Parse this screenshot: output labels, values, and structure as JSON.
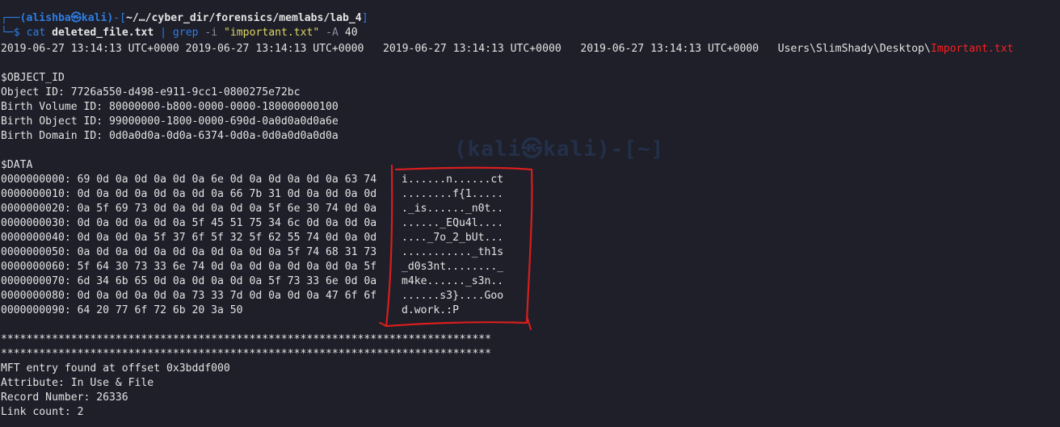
{
  "prompt": {
    "user_host": "(alishba㉿kali)",
    "path": "~/…/cyber_dir/forensics/memlabs/lab_4",
    "command": "cat",
    "file": "deleted_file.txt",
    "pipe": "|",
    "grep": "grep",
    "flag_i": "-i",
    "pattern": "\"important.txt\"",
    "flag_A": "-A",
    "count": "40"
  },
  "timestamps": {
    "prefix": "2019-06-27 13:14:13 UTC+0000 2019-06-27 13:14:13 UTC+0000   2019-06-27 13:14:13 UTC+0000   2019-06-27 13:14:13 UTC+0000   Users\\SlimShady\\Desktop\\",
    "highlight": "Important.txt"
  },
  "object_id": {
    "header": "$OBJECT_ID",
    "lines": [
      "Object ID: 7726a550-d498-e911-9cc1-0800275e72bc",
      "Birth Volume ID: 80000000-b800-0000-0000-180000000100",
      "Birth Object ID: 99000000-1800-0000-690d-0a0d0a0d0a6e",
      "Birth Domain ID: 0d0a0d0a-0d0a-6374-0d0a-0d0a0d0a0d0a"
    ]
  },
  "data": {
    "header": "$DATA",
    "rows": [
      {
        "offset": "0000000000:",
        "bytes": "69 0d 0a 0d 0a 0d 0a 6e 0d 0a 0d 0a 0d 0a 63 74",
        "ascii": "i......n......ct"
      },
      {
        "offset": "0000000010:",
        "bytes": "0d 0a 0d 0a 0d 0a 0d 0a 66 7b 31 0d 0a 0d 0a 0d",
        "ascii": "........f{1....."
      },
      {
        "offset": "0000000020:",
        "bytes": "0a 5f 69 73 0d 0a 0d 0a 0d 0a 5f 6e 30 74 0d 0a",
        "ascii": "._is......_n0t.."
      },
      {
        "offset": "0000000030:",
        "bytes": "0d 0a 0d 0a 0d 0a 5f 45 51 75 34 6c 0d 0a 0d 0a",
        "ascii": "......_EQu4l...."
      },
      {
        "offset": "0000000040:",
        "bytes": "0d 0a 0d 0a 5f 37 6f 5f 32 5f 62 55 74 0d 0a 0d",
        "ascii": "...._7o_2_bUt..."
      },
      {
        "offset": "0000000050:",
        "bytes": "0a 0d 0a 0d 0a 0d 0a 0d 0a 0d 0a 5f 74 68 31 73",
        "ascii": "..........._th1s"
      },
      {
        "offset": "0000000060:",
        "bytes": "5f 64 30 73 33 6e 74 0d 0a 0d 0a 0d 0a 0d 0a 5f",
        "ascii": "_d0s3nt........_"
      },
      {
        "offset": "0000000070:",
        "bytes": "6d 34 6b 65 0d 0a 0d 0a 0d 0a 5f 73 33 6e 0d 0a",
        "ascii": "m4ke......_s3n.."
      },
      {
        "offset": "0000000080:",
        "bytes": "0d 0a 0d 0a 0d 0a 73 33 7d 0d 0a 0d 0a 47 6f 6f",
        "ascii": "......s3}....Goo"
      },
      {
        "offset": "0000000090:",
        "bytes": "64 20 77 6f 72 6b 20 3a 50",
        "ascii": "d.work.:P"
      }
    ]
  },
  "footer": {
    "separator": "*****************************************************************************",
    "lines": [
      "MFT entry found at offset 0x3bddf000",
      "Attribute: In Use & File",
      "Record Number: 26336",
      "Link count: 2"
    ]
  },
  "watermark": "(kali㉿kali)-[~]",
  "colors": {
    "background": "#1e1f29",
    "prompt_blue": "#2f7de1",
    "highlight_red": "#ff1f1f",
    "string_yellow": "#e0d561",
    "annotation_red": "#d81e1e"
  }
}
